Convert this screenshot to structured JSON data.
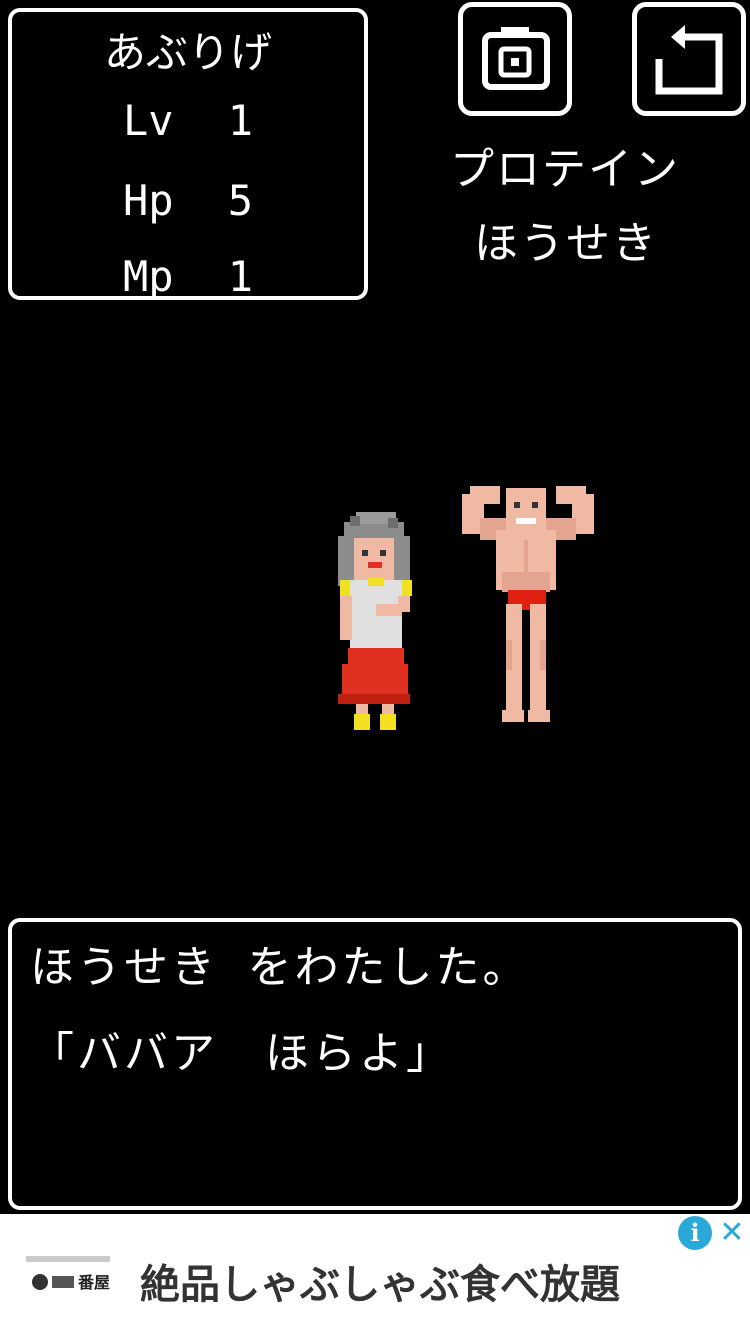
{
  "status": {
    "name": "あぶりげ",
    "lv_label": "Lv",
    "lv_value": "1",
    "hp_label": "Hp",
    "hp_value": "5",
    "mp_label": "Mp",
    "mp_value": "1"
  },
  "toolbar": {
    "camera_icon": "camera-icon",
    "back_icon": "return-arrow-icon"
  },
  "inventory": {
    "items": [
      "プロテイン",
      "ほうせき"
    ]
  },
  "message": {
    "lines": [
      "ほうせき をわたした。",
      "「ババア　ほらよ」"
    ]
  },
  "ad": {
    "title": "絶品しゃぶしゃぶ食べ放題",
    "info_icon": "info-icon",
    "close_icon": "close-icon",
    "logo_text": "番屋"
  },
  "colors": {
    "background": "#000000",
    "foreground": "#ffffff",
    "ad_accent": "#2aa8d8"
  }
}
